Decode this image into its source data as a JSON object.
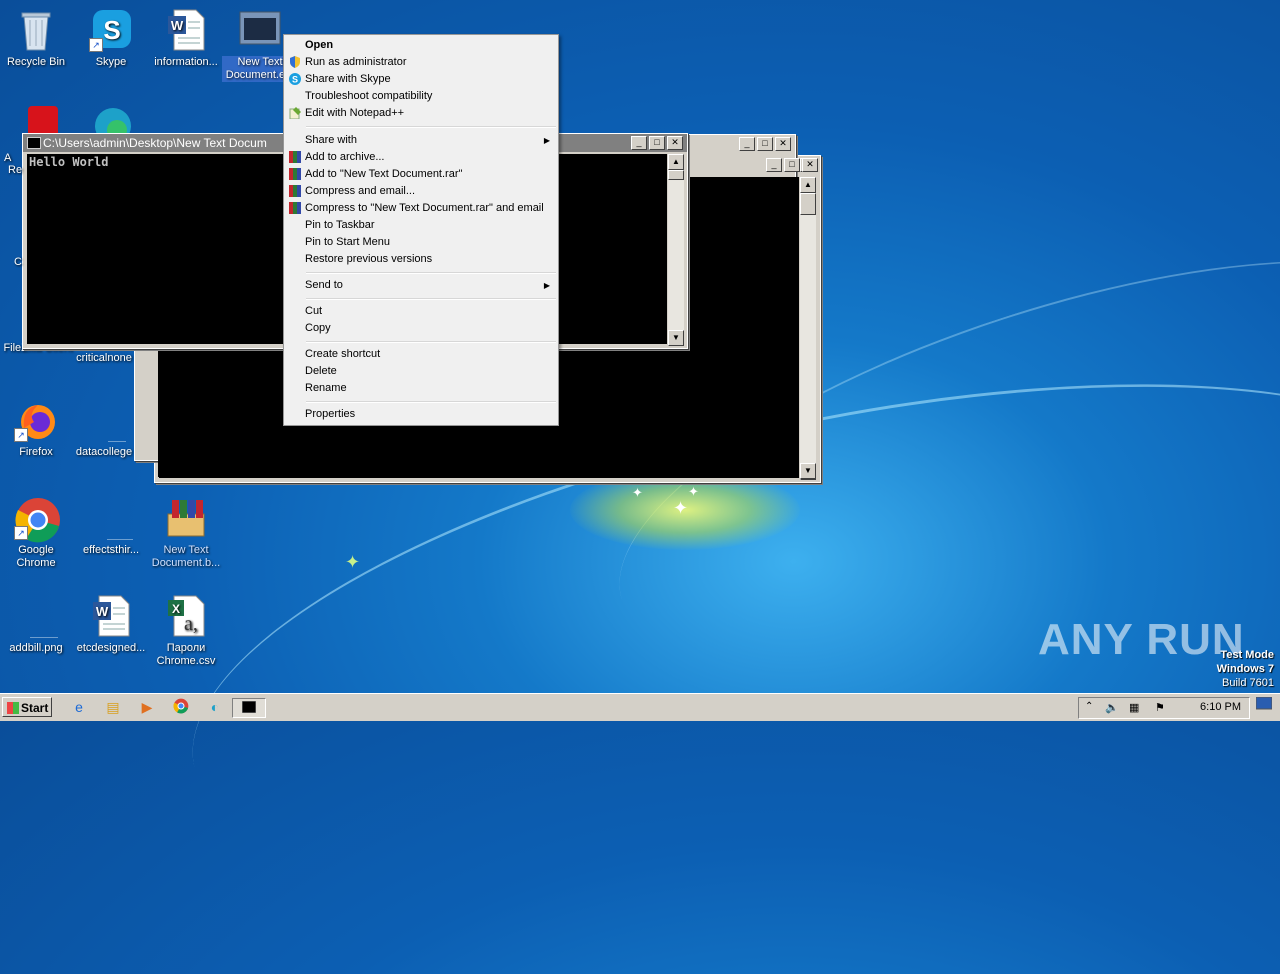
{
  "desktop": {
    "icons": [
      {
        "label": "Recycle Bin"
      },
      {
        "label": "Skype"
      },
      {
        "label": "information..."
      },
      {
        "label": "New Text Document.e..."
      },
      {
        "label": "FileZilla Client"
      },
      {
        "label": "criticalnone"
      },
      {
        "label": "Firefox"
      },
      {
        "label": "datacollege"
      },
      {
        "label": "Google Chrome"
      },
      {
        "label": "effectsthir..."
      },
      {
        "label": "New Text Document.b..."
      },
      {
        "label": "addbill.png"
      },
      {
        "label": "etcdesigned..."
      },
      {
        "label": "Пароли Chrome.csv"
      }
    ],
    "partial_labels": [
      "A",
      "Re",
      "C"
    ]
  },
  "console_front": {
    "title": "C:\\Users\\admin\\Desktop\\New Text Docum",
    "output": "Hello World"
  },
  "context_menu": {
    "items": [
      {
        "label": "Open",
        "bold": true,
        "icon": ""
      },
      {
        "label": "Run as administrator",
        "icon": "uac-shield-icon"
      },
      {
        "label": "Share with Skype",
        "icon": "skype-icon"
      },
      {
        "label": "Troubleshoot compatibility",
        "icon": ""
      },
      {
        "label": "Edit with Notepad++",
        "icon": "notepadpp-icon"
      },
      {
        "label": "Share with",
        "submenu": true
      },
      {
        "label": "Add to archive...",
        "icon": "winrar-icon"
      },
      {
        "label": "Add to \"New Text Document.rar\"",
        "icon": "winrar-icon"
      },
      {
        "label": "Compress and email...",
        "icon": "winrar-icon"
      },
      {
        "label": "Compress to \"New Text Document.rar\" and email",
        "icon": "winrar-icon"
      },
      {
        "label": "Pin to Taskbar"
      },
      {
        "label": "Pin to Start Menu"
      },
      {
        "label": "Restore previous versions"
      },
      {
        "label": "Send to",
        "submenu": true
      },
      {
        "label": "Cut"
      },
      {
        "label": "Copy"
      },
      {
        "label": "Create shortcut"
      },
      {
        "label": "Delete"
      },
      {
        "label": "Rename"
      },
      {
        "label": "Properties"
      }
    ]
  },
  "taskbar": {
    "start_label": "Start",
    "clock": "6:10 PM"
  },
  "watermark": {
    "brand": "ANY RUN",
    "mode_line1": "Test Mode",
    "mode_line2": "Windows 7",
    "mode_line3": "Build 7601"
  }
}
